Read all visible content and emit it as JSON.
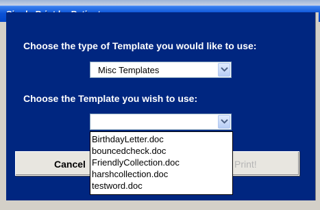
{
  "window": {
    "title": "Single Print by Patient"
  },
  "prompts": {
    "template_type_label": "Choose the type of Template you would like to use:",
    "template_label": "Choose the Template you wish to use:"
  },
  "template_type_combo": {
    "selected": "Misc Templates"
  },
  "template_combo": {
    "selected": "",
    "options": [
      "BirthdayLetter.doc",
      "bouncedcheck.doc",
      "FriendlyCollection.doc",
      "harshcollection.doc",
      "testword.doc"
    ]
  },
  "buttons": {
    "cancel": "Cancel",
    "print": "Print!"
  },
  "colors": {
    "panel_background": "#002680",
    "titlebar": "#0a52d6",
    "window_face": "#d4d0c8"
  }
}
